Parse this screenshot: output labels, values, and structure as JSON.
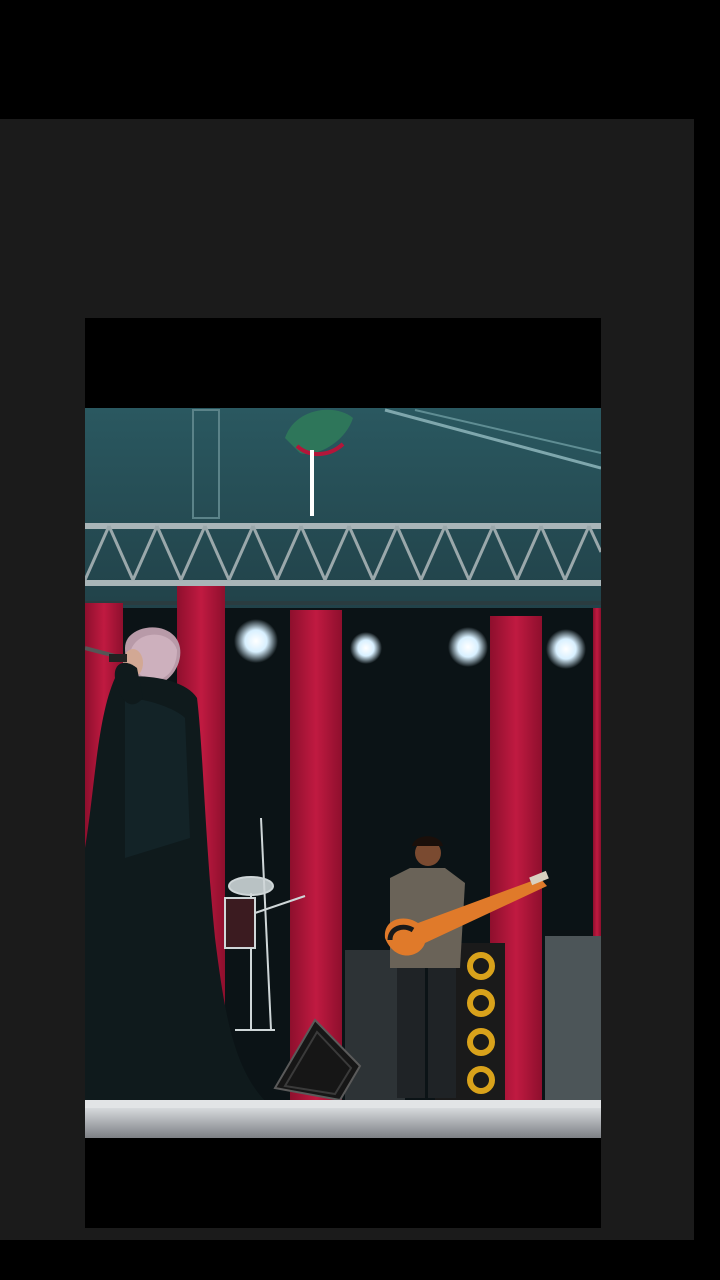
{
  "screen": {
    "type": "fullscreen-video-viewer",
    "background_color": "#000000",
    "panel_color": "#1b1b1b"
  },
  "video": {
    "scene": "concert-stage",
    "frame_bars_color": "#000000",
    "stage_colors": {
      "backdrop": "#1f3e45",
      "curtain_red": "#b3163a",
      "curtain_dark": "#0a0f12",
      "truss": "#9aa8ab",
      "spotlight": "#eaf6ff",
      "floor": "#c9ccd0"
    }
  }
}
